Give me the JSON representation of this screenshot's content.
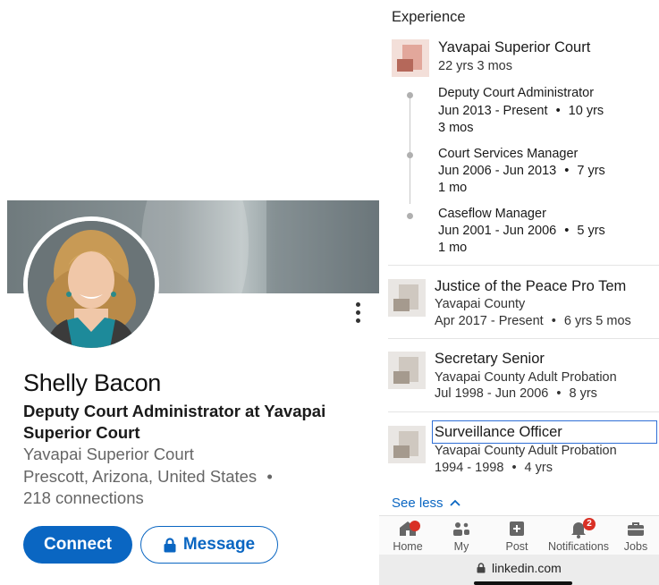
{
  "profile": {
    "name": "Shelly Bacon",
    "headline": "Deputy Court Administrator at Yavapai Superior Court",
    "company": "Yavapai Superior Court",
    "location": "Prescott, Arizona, United States",
    "location_sep": "•",
    "connections": "218 connections",
    "connect_label": "Connect",
    "message_label": "Message",
    "accent_color": "#0a66c2"
  },
  "experience": {
    "title": "Experience",
    "group": {
      "company": "Yavapai Superior Court",
      "duration": "22 yrs 3 mos",
      "roles": [
        {
          "title": "Deputy Court Administrator",
          "dates": "Jun 2013 - Present",
          "sep": "•",
          "dur1": "10 yrs",
          "dur2": "3 mos"
        },
        {
          "title": "Court Services Manager",
          "dates": "Jun 2006 - Jun 2013",
          "sep": "•",
          "dur1": "7 yrs",
          "dur2": "1 mo"
        },
        {
          "title": "Caseflow Manager",
          "dates": "Jun 2001 - Jun 2006",
          "sep": "•",
          "dur1": "5 yrs",
          "dur2": "1 mo"
        }
      ]
    },
    "positions": [
      {
        "title": "Justice of the Peace Pro Tem",
        "company": "Yavapai County",
        "dates": "Apr 2017 - Present",
        "sep": "•",
        "duration": "6 yrs 5 mos"
      },
      {
        "title": "Secretary Senior",
        "company": "Yavapai County Adult Probation",
        "dates": "Jul 1998 - Jun 2006",
        "sep": "•",
        "duration": "8 yrs"
      },
      {
        "title": "Surveillance Officer",
        "company": "Yavapai County Adult Probation",
        "dates": "1994 - 1998",
        "sep": "•",
        "duration": "4 yrs"
      }
    ],
    "see_less": "See less",
    "see_less_icon": "chevron-up-icon"
  },
  "nav": {
    "items": [
      {
        "label": "Home",
        "icon": "home-icon"
      },
      {
        "label": "My",
        "icon": "network-icon"
      },
      {
        "label": "Post",
        "icon": "plus-square-icon"
      },
      {
        "label": "Notifications",
        "icon": "bell-icon",
        "badge": "2"
      },
      {
        "label": "Jobs",
        "icon": "briefcase-icon"
      }
    ]
  },
  "browser": {
    "url": "linkedin.com",
    "lock_icon": "lock-icon"
  }
}
